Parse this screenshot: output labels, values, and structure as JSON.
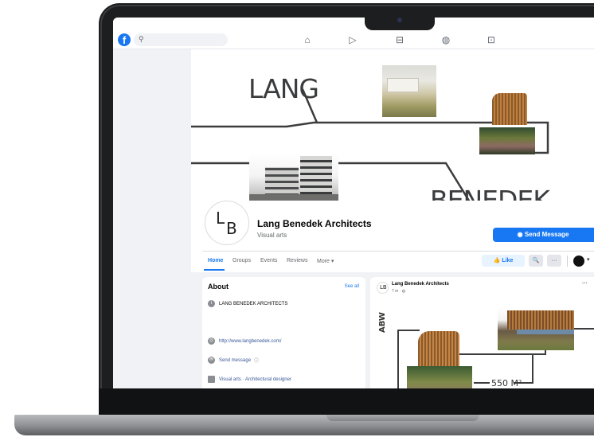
{
  "topbar": {
    "logo": "f",
    "search_icon": "⚲",
    "nav_icons": [
      "home-icon",
      "watch-icon",
      "marketplace-icon",
      "groups-icon",
      "gaming-icon"
    ]
  },
  "cover": {
    "word_top": "LANG",
    "word_bottom": "BENEDEK",
    "area_label": "550 M²",
    "side_label": "ABW"
  },
  "page": {
    "avatar_letter_1": "L",
    "avatar_letter_2": "B",
    "name": "Lang Benedek Architects",
    "category": "Visual arts",
    "send_message": "Send Message"
  },
  "tabs": [
    "Home",
    "Groups",
    "Events",
    "Reviews",
    "More ▾"
  ],
  "actions": {
    "like": "Like",
    "search_btn": "🔍",
    "more_btn": "···",
    "caret": "▾"
  },
  "about": {
    "title": "About",
    "see_all": "See all",
    "rows": [
      "LANG BENEDEK ARCHITECTS",
      "http://www.langbenedek.com/",
      "Send message",
      "Visual arts · Architectural designer"
    ]
  },
  "post": {
    "author": "Lang Benedek Architects",
    "time": "7 m · ",
    "more": "···"
  },
  "colors": {
    "brand": "#1877f2",
    "page_bg": "#f0f2f5",
    "laptop": "#1d1e20"
  }
}
